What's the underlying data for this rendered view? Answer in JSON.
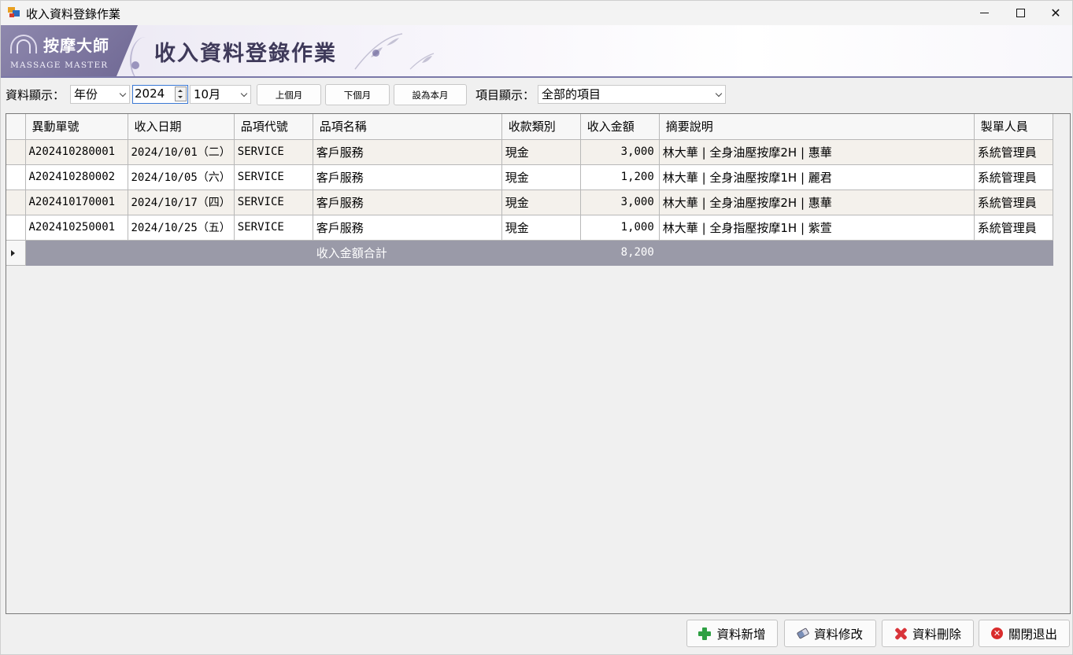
{
  "window": {
    "title": "收入資料登錄作業"
  },
  "banner": {
    "logo_cn": "按摩大師",
    "logo_en": "MASSAGE MASTER",
    "title": "收入資料登錄作業"
  },
  "toolbar": {
    "display_label": "資料顯示：",
    "mode_value": "年份",
    "year_value": "2024",
    "month_value": "10月",
    "prev_month": "上個月",
    "next_month": "下個月",
    "this_month": "設為本月",
    "item_label": "項目顯示：",
    "item_value": "全部的項目"
  },
  "grid": {
    "columns": [
      "異動單號",
      "收入日期",
      "品項代號",
      "品項名稱",
      "收款類別",
      "收入金額",
      "摘要說明",
      "製單人員"
    ],
    "rows": [
      [
        "A202410280001",
        "2024/10/01（二）",
        "SERVICE",
        "客戶服務",
        "現金",
        "3,000",
        "林大華 | 全身油壓按摩2H | 惠華",
        "系統管理員"
      ],
      [
        "A202410280002",
        "2024/10/05（六）",
        "SERVICE",
        "客戶服務",
        "現金",
        "1,200",
        "林大華 | 全身油壓按摩1H | 麗君",
        "系統管理員"
      ],
      [
        "A202410170001",
        "2024/10/17（四）",
        "SERVICE",
        "客戶服務",
        "現金",
        "3,000",
        "林大華 | 全身油壓按摩2H | 惠華",
        "系統管理員"
      ],
      [
        "A202410250001",
        "2024/10/25（五）",
        "SERVICE",
        "客戶服務",
        "現金",
        "1,000",
        "林大華 | 全身指壓按摩1H | 紫萱",
        "系統管理員"
      ]
    ],
    "total_label": "收入金額合計",
    "total_value": "8,200"
  },
  "actions": {
    "add": "資料新增",
    "edit": "資料修改",
    "delete": "資料刪除",
    "exit": "關閉退出"
  }
}
